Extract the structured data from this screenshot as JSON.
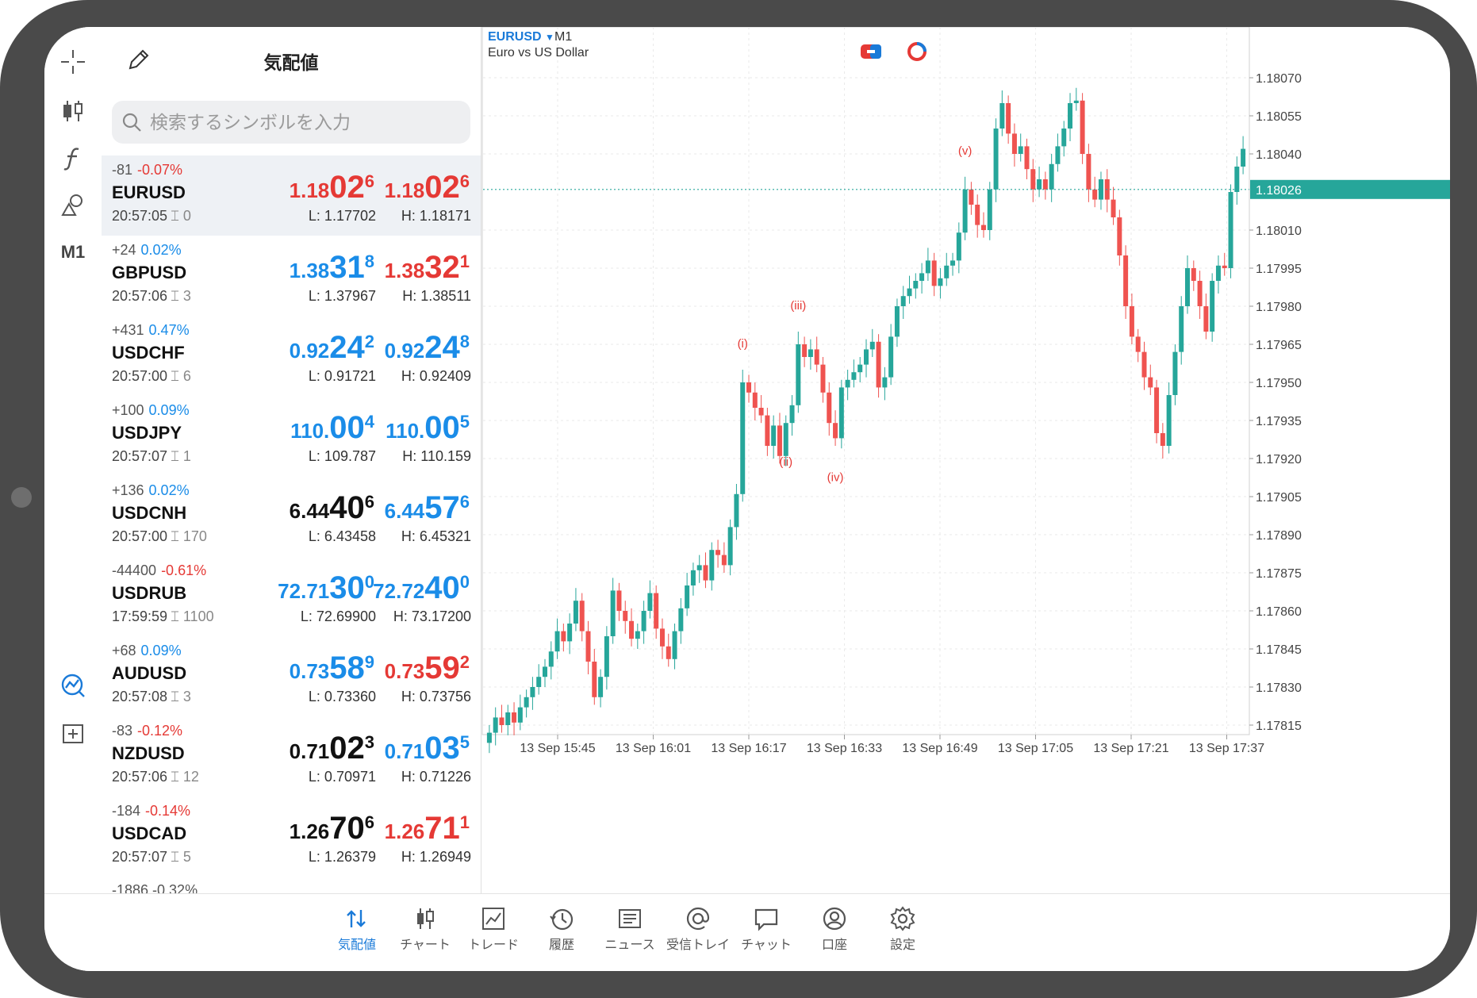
{
  "quotes_panel": {
    "title": "気配値",
    "search_placeholder": "検索するシンボルを入力",
    "symbols": [
      {
        "change": "-81",
        "pct": "-0.07%",
        "dir": "down",
        "symbol": "EURUSD",
        "time": "20:57:05",
        "spread": "0",
        "bid": {
          "small": "1.18",
          "big": "02",
          "sup": "6",
          "color": "down"
        },
        "ask": {
          "small": "1.18",
          "big": "02",
          "sup": "6",
          "color": "down"
        },
        "low": "L: 1.17702",
        "high": "H: 1.18171"
      },
      {
        "change": "+24",
        "pct": "0.02%",
        "dir": "up",
        "symbol": "GBPUSD",
        "time": "20:57:06",
        "spread": "3",
        "bid": {
          "small": "1.38",
          "big": "31",
          "sup": "8",
          "color": "up"
        },
        "ask": {
          "small": "1.38",
          "big": "32",
          "sup": "1",
          "color": "down"
        },
        "low": "L: 1.37967",
        "high": "H: 1.38511"
      },
      {
        "change": "+431",
        "pct": "0.47%",
        "dir": "up",
        "symbol": "USDCHF",
        "time": "20:57:00",
        "spread": "6",
        "bid": {
          "small": "0.92",
          "big": "24",
          "sup": "2",
          "color": "up"
        },
        "ask": {
          "small": "0.92",
          "big": "24",
          "sup": "8",
          "color": "up"
        },
        "low": "L: 0.91721",
        "high": "H: 0.92409"
      },
      {
        "change": "+100",
        "pct": "0.09%",
        "dir": "up",
        "symbol": "USDJPY",
        "time": "20:57:07",
        "spread": "1",
        "bid": {
          "small": "110.",
          "big": "00",
          "sup": "4",
          "color": "up"
        },
        "ask": {
          "small": "110.",
          "big": "00",
          "sup": "5",
          "color": "up"
        },
        "low": "L: 109.787",
        "high": "H: 110.159"
      },
      {
        "change": "+136",
        "pct": "0.02%",
        "dir": "up",
        "symbol": "USDCNH",
        "time": "20:57:00",
        "spread": "170",
        "bid": {
          "small": "6.44",
          "big": "40",
          "sup": "6",
          "color": "flat"
        },
        "ask": {
          "small": "6.44",
          "big": "57",
          "sup": "6",
          "color": "up"
        },
        "low": "L: 6.43458",
        "high": "H: 6.45321"
      },
      {
        "change": "-44400",
        "pct": "-0.61%",
        "dir": "down",
        "symbol": "USDRUB",
        "time": "17:59:59",
        "spread": "1100",
        "bid": {
          "small": "72.71",
          "big": "30",
          "sup": "0",
          "color": "up"
        },
        "ask": {
          "small": "72.72",
          "big": "40",
          "sup": "0",
          "color": "up"
        },
        "low": "L: 72.69900",
        "high": "H: 73.17200"
      },
      {
        "change": "+68",
        "pct": "0.09%",
        "dir": "up",
        "symbol": "AUDUSD",
        "time": "20:57:08",
        "spread": "3",
        "bid": {
          "small": "0.73",
          "big": "58",
          "sup": "9",
          "color": "up"
        },
        "ask": {
          "small": "0.73",
          "big": "59",
          "sup": "2",
          "color": "down"
        },
        "low": "L: 0.73360",
        "high": "H: 0.73756"
      },
      {
        "change": "-83",
        "pct": "-0.12%",
        "dir": "down",
        "symbol": "NZDUSD",
        "time": "20:57:06",
        "spread": "12",
        "bid": {
          "small": "0.71",
          "big": "02",
          "sup": "3",
          "color": "flat"
        },
        "ask": {
          "small": "0.71",
          "big": "03",
          "sup": "5",
          "color": "up"
        },
        "low": "L: 0.70971",
        "high": "H: 0.71226"
      },
      {
        "change": "-184",
        "pct": "-0.14%",
        "dir": "down",
        "symbol": "USDCAD",
        "time": "20:57:07",
        "spread": "5",
        "bid": {
          "small": "1.26",
          "big": "70",
          "sup": "6",
          "color": "flat"
        },
        "ask": {
          "small": "1.26",
          "big": "71",
          "sup": "1",
          "color": "down"
        },
        "low": "L: 1.26379",
        "high": "H: 1.26949"
      }
    ],
    "cut_row_text": "-1886 -0.32%"
  },
  "toolbar": {
    "timeframe_label": "M1",
    "icons": [
      "crosshair-icon",
      "candlestick-icon",
      "function-icon",
      "objects-icon",
      "timeframe-label",
      "trade-signals-icon",
      "add-window-icon"
    ]
  },
  "chart": {
    "symbol": "EURUSD",
    "timeframe": "M1",
    "description": "Euro vs US Dollar",
    "current_price_label": "1.18026",
    "current_price": 1.18026,
    "price_axis_labels": [
      "1.18070",
      "1.18055",
      "1.18040",
      "1.18010",
      "1.17995",
      "1.17980",
      "1.17965",
      "1.17950",
      "1.17935",
      "1.17920",
      "1.17905",
      "1.17890",
      "1.17875",
      "1.17860",
      "1.17845",
      "1.17830",
      "1.17815"
    ],
    "time_axis_labels": [
      "13 Sep 15:45",
      "13 Sep 16:01",
      "13 Sep 16:17",
      "13 Sep 16:33",
      "13 Sep 16:49",
      "13 Sep 17:05",
      "13 Sep 17:21",
      "13 Sep 17:37"
    ],
    "wave_labels": [
      "(i)",
      "(ii)",
      "(iii)",
      "(iv)",
      "(v)"
    ],
    "colors": {
      "bull": "#26a69a",
      "bear": "#ef5350",
      "price_line": "#26a69a"
    }
  },
  "chart_data": {
    "type": "candlestick",
    "title": "EURUSD M1",
    "ylim": [
      1.17805,
      1.18075
    ],
    "closes": [
      1.17812,
      1.17818,
      1.17815,
      1.1782,
      1.17816,
      1.17822,
      1.17826,
      1.1783,
      1.17834,
      1.17838,
      1.17844,
      1.17852,
      1.17848,
      1.17855,
      1.17864,
      1.17852,
      1.1784,
      1.17826,
      1.17834,
      1.1785,
      1.17868,
      1.1786,
      1.17856,
      1.17849,
      1.17852,
      1.1786,
      1.17867,
      1.17853,
      1.17846,
      1.17841,
      1.17852,
      1.17861,
      1.1787,
      1.17876,
      1.17878,
      1.17872,
      1.17884,
      1.17882,
      1.17878,
      1.17893,
      1.17906,
      1.1795,
      1.17946,
      1.1794,
      1.17937,
      1.17925,
      1.17933,
      1.17921,
      1.17934,
      1.17941,
      1.17965,
      1.1796,
      1.17963,
      1.17957,
      1.17946,
      1.17934,
      1.17928,
      1.17948,
      1.17951,
      1.17954,
      1.17957,
      1.17963,
      1.17966,
      1.17948,
      1.17952,
      1.17968,
      1.1798,
      1.17984,
      1.17987,
      1.1799,
      1.17993,
      1.17998,
      1.17988,
      1.17991,
      1.17996,
      1.17998,
      1.18009,
      1.18026,
      1.1802,
      1.18012,
      1.1801,
      1.18026,
      1.1805,
      1.1806,
      1.18048,
      1.1804,
      1.18043,
      1.18034,
      1.18026,
      1.1803,
      1.18026,
      1.18036,
      1.18043,
      1.1805,
      1.1806,
      1.18061,
      1.1804,
      1.18026,
      1.18022,
      1.1803,
      1.18022,
      1.18015,
      1.18,
      1.1798,
      1.17968,
      1.17962,
      1.17952,
      1.17948,
      1.1793,
      1.17925,
      1.17945,
      1.17962,
      1.1798,
      1.17995,
      1.1799,
      1.1798,
      1.1797,
      1.1799,
      1.17996,
      1.17995,
      1.18025,
      1.18035,
      1.18042
    ],
    "wave_points": [
      {
        "label": "(i)",
        "index": 41
      },
      {
        "label": "(ii)",
        "index": 48
      },
      {
        "label": "(iii)",
        "index": 50
      },
      {
        "label": "(iv)",
        "index": 56
      },
      {
        "label": "(v)",
        "index": 77
      }
    ]
  },
  "tabbar": {
    "tabs": [
      {
        "label": "気配値",
        "active": true
      },
      {
        "label": "チャート",
        "active": false
      },
      {
        "label": "トレード",
        "active": false
      },
      {
        "label": "履歴",
        "active": false
      },
      {
        "label": "ニュース",
        "active": false
      },
      {
        "label": "受信トレイ",
        "active": false
      },
      {
        "label": "チャット",
        "active": false
      },
      {
        "label": "口座",
        "active": false
      },
      {
        "label": "設定",
        "active": false
      }
    ]
  }
}
